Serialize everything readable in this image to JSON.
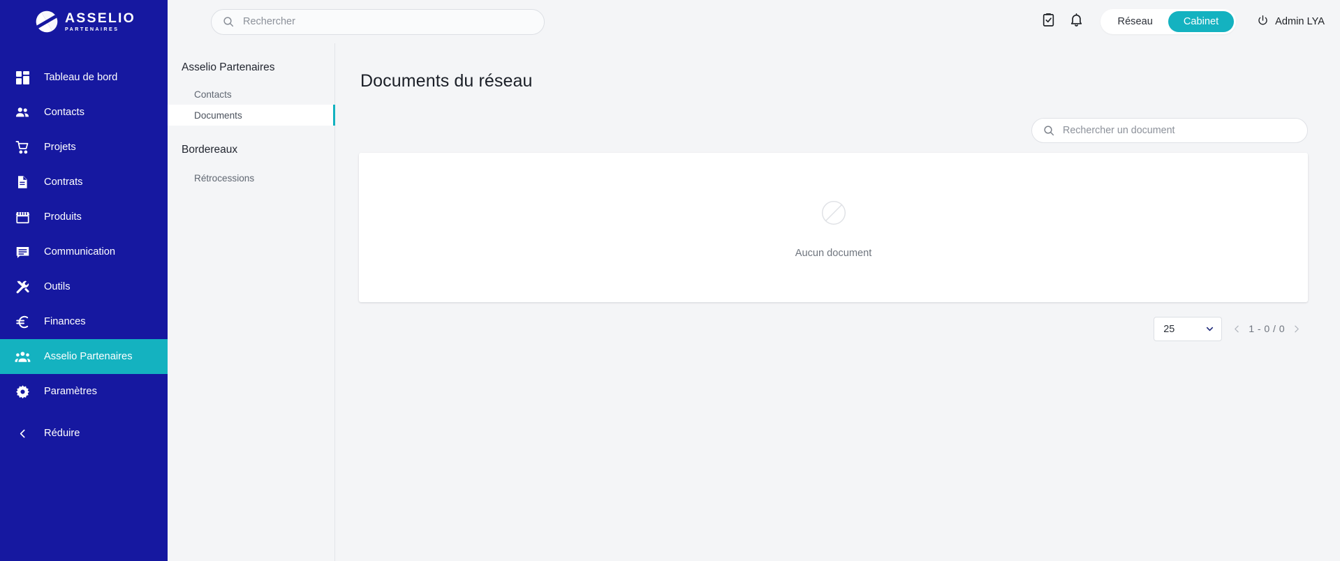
{
  "brand": {
    "name": "ASSELIO",
    "tagline": "PARTENAIRES",
    "navy": "#1618a0",
    "teal": "#14b2c0"
  },
  "sidebar": {
    "items": [
      {
        "label": "Tableau de bord",
        "icon": "dashboard-icon",
        "active": false
      },
      {
        "label": "Contacts",
        "icon": "contacts-icon",
        "active": false
      },
      {
        "label": "Projets",
        "icon": "cart-icon",
        "active": false
      },
      {
        "label": "Contrats",
        "icon": "document-icon",
        "active": false
      },
      {
        "label": "Produits",
        "icon": "store-icon",
        "active": false
      },
      {
        "label": "Communication",
        "icon": "message-icon",
        "active": false
      },
      {
        "label": "Outils",
        "icon": "tools-icon",
        "active": false
      },
      {
        "label": "Finances",
        "icon": "euro-icon",
        "active": false
      },
      {
        "label": "Asselio Partenaires",
        "icon": "group-icon",
        "active": true
      },
      {
        "label": "Paramètres",
        "icon": "gear-icon",
        "active": false
      }
    ],
    "collapse_label": "Réduire"
  },
  "topbar": {
    "search_placeholder": "Rechercher",
    "search_value": "",
    "tasks_icon": "clipboard-check-icon",
    "notifications_icon": "bell-icon",
    "scope_toggle": {
      "options": [
        "Réseau",
        "Cabinet"
      ],
      "selected": "Cabinet"
    },
    "user": {
      "name": "Admin LYA",
      "icon": "power-icon"
    }
  },
  "subnav": {
    "groups": [
      {
        "title": "Asselio Partenaires",
        "items": [
          {
            "label": "Contacts",
            "active": false
          },
          {
            "label": "Documents",
            "active": true
          }
        ]
      },
      {
        "title": "Bordereaux",
        "items": [
          {
            "label": "Rétrocessions",
            "active": false
          }
        ]
      }
    ]
  },
  "content": {
    "page_title": "Documents du réseau",
    "doc_search_placeholder": "Rechercher un document",
    "doc_search_value": "",
    "empty_state": {
      "icon": "empty-circle-slash-icon",
      "message": "Aucun document"
    },
    "pagination": {
      "page_size": "25",
      "range_label": "1 - 0 / 0",
      "prev_icon": "chevron-left-icon",
      "next_icon": "chevron-right-icon"
    }
  }
}
